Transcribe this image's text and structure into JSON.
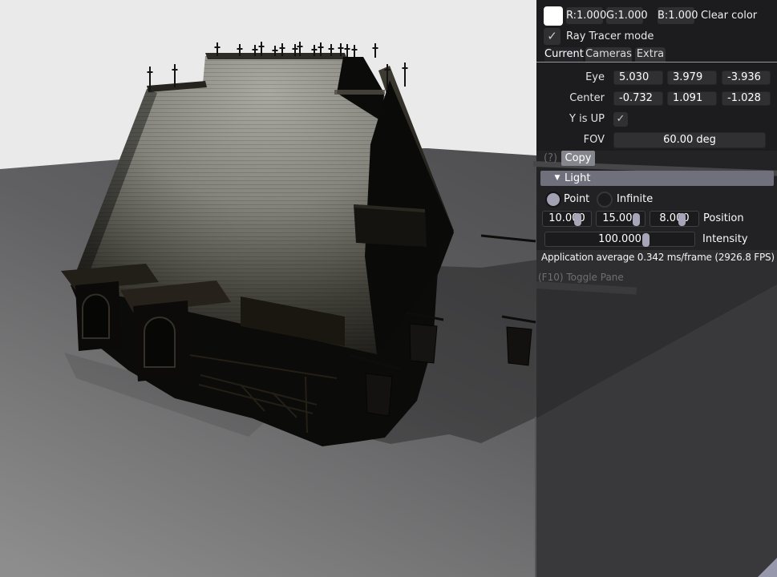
{
  "color_row": {
    "swatch_color": "#ffffff",
    "r": "R:1.000",
    "g": "G:1.000",
    "b": "B:1.000",
    "clear": "Clear color"
  },
  "ray_tracer": {
    "label": "Ray Tracer mode",
    "checked": true
  },
  "tabs": [
    {
      "label": "Current",
      "active": true
    },
    {
      "label": "Cameras",
      "active": false
    },
    {
      "label": "Extra",
      "active": false
    }
  ],
  "camera": {
    "eye_label": "Eye",
    "eye": [
      "5.030",
      "3.979",
      "-3.936"
    ],
    "center_label": "Center",
    "center": [
      "-0.732",
      "1.091",
      "-1.028"
    ],
    "y_up_label": "Y is UP",
    "y_up_checked": true,
    "fov_label": "FOV",
    "fov_value": "60.00 deg"
  },
  "footer": {
    "help": "(?)",
    "copy": "Copy"
  },
  "light": {
    "title": "Light",
    "type_point": "Point",
    "type_infinite": "Infinite",
    "selected_type": "Point",
    "position": {
      "values": [
        "10.000",
        "15.000",
        "8.000"
      ],
      "label": "Position"
    },
    "intensity": {
      "value": "100.000",
      "label": "Intensity"
    }
  },
  "status": {
    "fps": "Application average 0.342 ms/frame (2926.8 FPS)",
    "toggle_pane": "(F10) Toggle Pane"
  },
  "icons": {
    "check": "✓",
    "collapse": "▼"
  },
  "colors": {
    "panel_bg": "#1c1c1e",
    "field_bg": "#303033",
    "slider_handle": "#a6a6b8",
    "light_header_bg": "#70707c",
    "sky": "#eaeaeb",
    "copy_button_bg": "#85858e"
  }
}
